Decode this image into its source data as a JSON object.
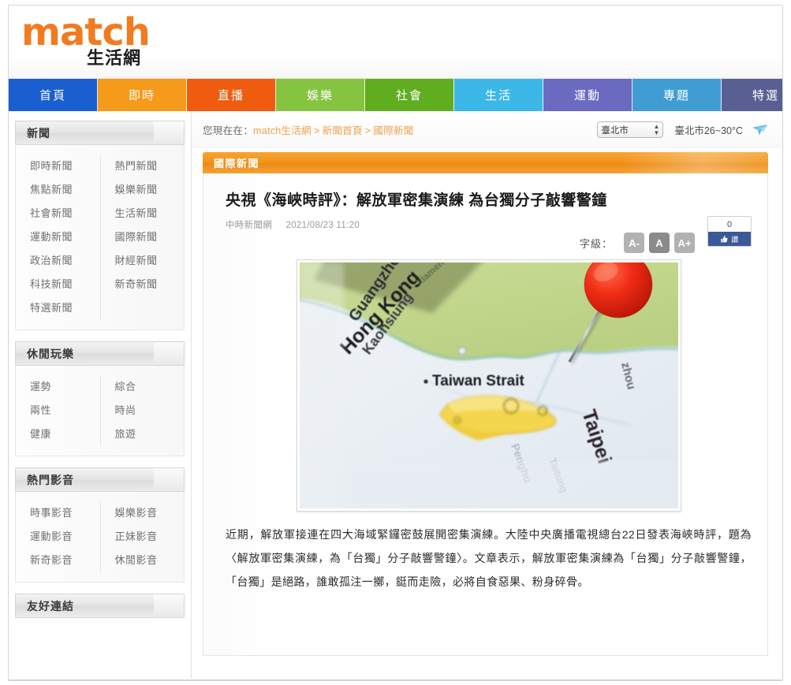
{
  "site": {
    "logo_main": "match",
    "logo_sub": "生活網"
  },
  "nav": {
    "items": [
      {
        "label": "首頁",
        "color": "#1a5fd0"
      },
      {
        "label": "即時",
        "color": "#f59a1a"
      },
      {
        "label": "直播",
        "color": "#ef5c10"
      },
      {
        "label": "娛樂",
        "color": "#85c441"
      },
      {
        "label": "社會",
        "color": "#60ad20"
      },
      {
        "label": "生活",
        "color": "#3cb8e8"
      },
      {
        "label": "運動",
        "color": "#6a6ac0"
      },
      {
        "label": "專題",
        "color": "#3f9dd4"
      },
      {
        "label": "特選",
        "color": "#5a5f93"
      }
    ],
    "tail_color": "#f5891f"
  },
  "sidebar": {
    "panels": [
      {
        "title": "新聞",
        "col1": [
          "即時新聞",
          "焦點新聞",
          "社會新聞",
          "運動新聞",
          "政治新聞",
          "科技新聞",
          "特選新聞"
        ],
        "col2": [
          "熱門新聞",
          "娛樂新聞",
          "生活新聞",
          "國際新聞",
          "財經新聞",
          "新奇新聞"
        ]
      },
      {
        "title": "休閒玩樂",
        "col1": [
          "運勢",
          "兩性",
          "健康"
        ],
        "col2": [
          "綜合",
          "時尚",
          "旅遊"
        ]
      },
      {
        "title": "熱門影音",
        "col1": [
          "時事影音",
          "運動影音",
          "新奇影音"
        ],
        "col2": [
          "娛樂影音",
          "正妹影音",
          "休閒影音"
        ]
      }
    ],
    "footer_panel_title": "友好連結"
  },
  "breadcrumb": {
    "prefix": "您現在在：",
    "items": [
      "match生活網",
      "新聞首頁",
      "國際新聞"
    ],
    "separator": ">"
  },
  "weather": {
    "city_selected": "臺北市",
    "city_options": [
      "臺北市"
    ],
    "summary": "臺北市26~30°C",
    "icon": "weather-cloud-icon"
  },
  "section": {
    "tab_label": "國際新聞"
  },
  "article": {
    "title": "央視《海峽時評》：解放軍密集演練 為台獨分子敲響警鐘",
    "source": "中時新聞網",
    "datetime": "2021/08/23 11:20",
    "fontsize": {
      "label": "字級：",
      "buttons": [
        {
          "label": "A-",
          "name": "font-decrease",
          "active": false
        },
        {
          "label": "A",
          "name": "font-normal",
          "active": true
        },
        {
          "label": "A+",
          "name": "font-increase",
          "active": false
        }
      ]
    },
    "like": {
      "count": "0",
      "button_label": "讚"
    },
    "photo": {
      "alt": "map-taiwan-strait-pushpin",
      "labels": [
        "Guangzhou",
        "Kaohsiung",
        "Hong Kong",
        "Taiwan Strait",
        "Taipei",
        "Fuzhou",
        "Xiamen"
      ]
    },
    "body": "近期，解放軍接連在四大海域緊鑼密鼓展開密集演練。大陸中央廣播電視總台22日發表海峽時評，題為〈解放軍密集演練，為「台獨」分子敲響警鐘〉。文章表示，解放軍密集演練為「台獨」分子敲響警鐘，「台獨」是絕路，誰敢孤注一擲，鋌而走險，必將自食惡果、粉身碎骨。"
  }
}
